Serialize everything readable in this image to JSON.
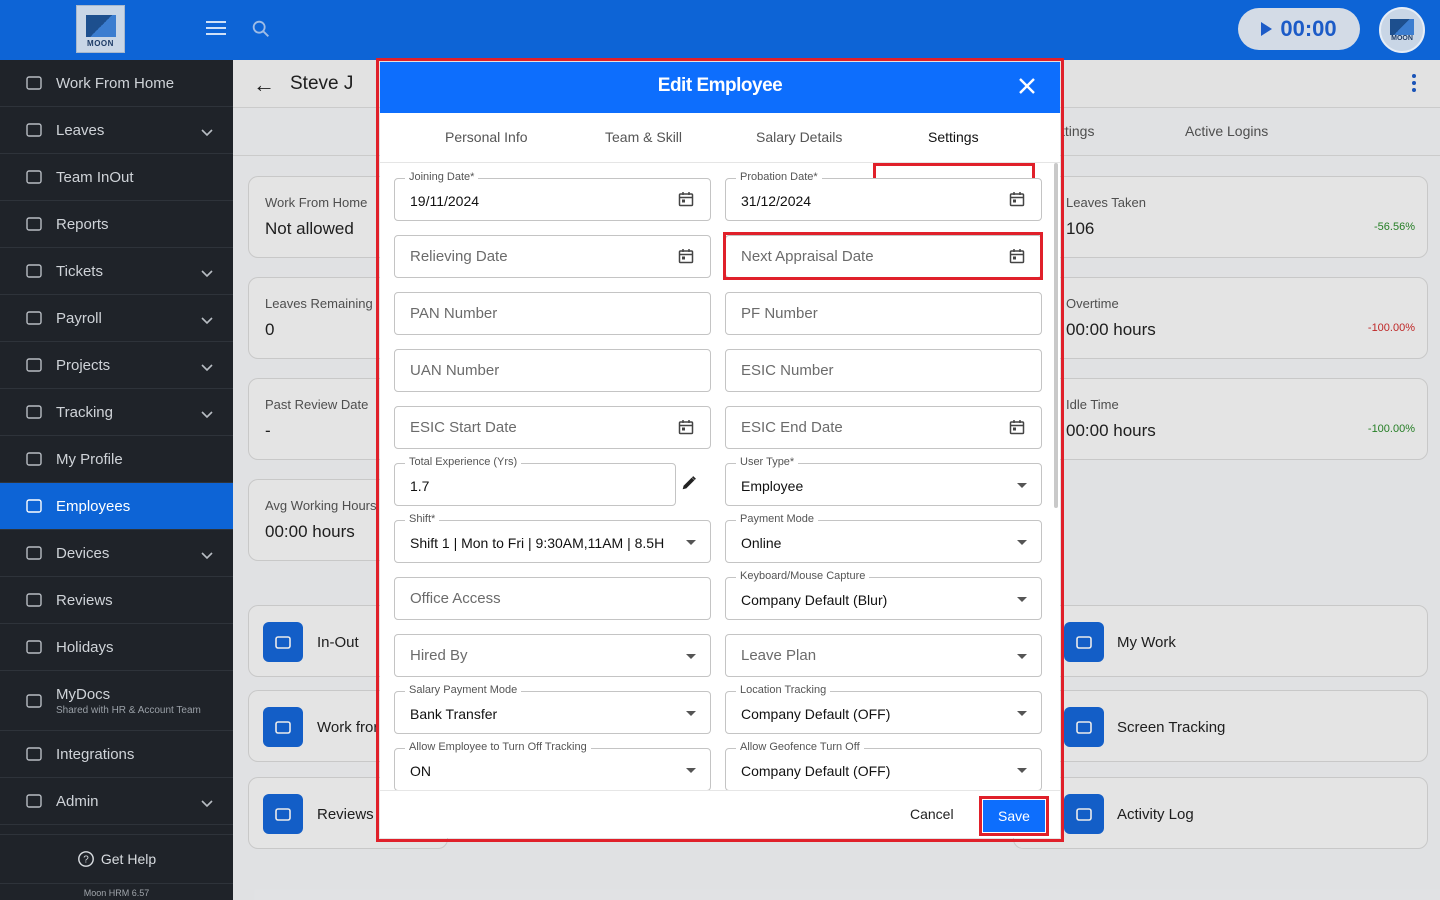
{
  "topbar": {
    "logo_text": "MOON",
    "timer": "00:00",
    "avatar_text": "MOON"
  },
  "sidebar": {
    "items": [
      {
        "label": "Work From Home",
        "icon": "home-icon",
        "has_chevron": false
      },
      {
        "label": "Leaves",
        "icon": "calendar-icon",
        "has_chevron": true
      },
      {
        "label": "Team InOut",
        "icon": "team-icon",
        "has_chevron": false
      },
      {
        "label": "Reports",
        "icon": "report-icon",
        "has_chevron": false
      },
      {
        "label": "Tickets",
        "icon": "ticket-icon",
        "has_chevron": true
      },
      {
        "label": "Payroll",
        "icon": "payroll-icon",
        "has_chevron": true
      },
      {
        "label": "Projects",
        "icon": "projects-icon",
        "has_chevron": true
      },
      {
        "label": "Tracking",
        "icon": "tracking-icon",
        "has_chevron": true
      },
      {
        "label": "My Profile",
        "icon": "user-icon",
        "has_chevron": false
      },
      {
        "label": "Employees",
        "icon": "employees-icon",
        "has_chevron": false,
        "active": true
      },
      {
        "label": "Devices",
        "icon": "devices-icon",
        "has_chevron": true
      },
      {
        "label": "Reviews",
        "icon": "reviews-icon",
        "has_chevron": false
      },
      {
        "label": "Holidays",
        "icon": "holidays-icon",
        "has_chevron": false
      },
      {
        "label": "MyDocs",
        "sub": "Shared with HR & Account Team",
        "icon": "folder-icon",
        "has_chevron": false
      },
      {
        "label": "Integrations",
        "icon": "integrations-icon",
        "has_chevron": false
      },
      {
        "label": "Admin",
        "icon": "admin-icon",
        "has_chevron": true
      }
    ],
    "get_help": "Get Help",
    "version": "Moon HRM 6.57"
  },
  "page": {
    "employee_name": "Steve J",
    "tabs": [
      "ttings",
      "Active Logins"
    ],
    "cards_left": [
      {
        "label": "Work From Home",
        "value": "Not allowed"
      },
      {
        "label": "Leaves Remaining",
        "value": "0"
      },
      {
        "label": "Past Review Date",
        "value": "-"
      },
      {
        "label": "Avg Working Hours",
        "value": "00:00 hours"
      }
    ],
    "cards_right": [
      {
        "label": "Leaves Taken",
        "value": "106",
        "pct": "-56.56%",
        "pct_color": "#2a8a2a"
      },
      {
        "label": "Overtime",
        "value": "00:00 hours",
        "pct": "-100.00%",
        "pct_color": "#d02b2b"
      },
      {
        "label": "Idle Time",
        "value": "00:00 hours",
        "pct": "-100.00%",
        "pct_color": "#2a8a2a"
      }
    ],
    "quick_left": [
      "In-Out",
      "Work fror",
      "Reviews"
    ],
    "quick_right": [
      "My Work",
      "Screen Tracking",
      "Activity Log"
    ]
  },
  "modal": {
    "title": "Edit Employee",
    "tabs": [
      "Personal Info",
      "Team & Skill",
      "Salary Details",
      "Settings"
    ],
    "active_tab": "Settings",
    "fields": {
      "joining_date": {
        "label": "Joining Date*",
        "value": "19/11/2024"
      },
      "probation_date": {
        "label": "Probation Date*",
        "value": "31/12/2024"
      },
      "relieving_date": {
        "placeholder": "Relieving Date"
      },
      "next_appraisal_date": {
        "placeholder": "Next Appraisal Date"
      },
      "pan_number": {
        "placeholder": "PAN Number"
      },
      "pf_number": {
        "placeholder": "PF Number"
      },
      "uan_number": {
        "placeholder": "UAN Number"
      },
      "esic_number": {
        "placeholder": "ESIC Number"
      },
      "esic_start_date": {
        "placeholder": "ESIC Start Date"
      },
      "esic_end_date": {
        "placeholder": "ESIC End Date"
      },
      "total_experience": {
        "label": "Total Experience (Yrs)",
        "value": "1.7"
      },
      "user_type": {
        "label": "User Type*",
        "value": "Employee"
      },
      "shift": {
        "label": "Shift*",
        "value": "Shift 1 | Mon to Fri | 9:30AM,11AM | 8.5H"
      },
      "payment_mode": {
        "label": "Payment Mode",
        "value": "Online"
      },
      "office_access": {
        "placeholder": "Office Access"
      },
      "keyboard_mouse_capture": {
        "label": "Keyboard/Mouse Capture",
        "value": "Company Default (Blur)"
      },
      "hired_by": {
        "placeholder": "Hired By"
      },
      "leave_plan": {
        "placeholder": "Leave Plan"
      },
      "salary_payment_mode": {
        "label": "Salary Payment Mode",
        "value": "Bank Transfer"
      },
      "location_tracking": {
        "label": "Location Tracking",
        "value": "Company Default (OFF)"
      },
      "allow_turn_off_tracking": {
        "label": "Allow Employee to Turn Off Tracking",
        "value": "ON"
      },
      "allow_geofence_turn_off": {
        "label": "Allow Geofence Turn Off",
        "value": "Company Default (OFF)"
      }
    },
    "cancel_label": "Cancel",
    "save_label": "Save"
  },
  "colors": {
    "primary": "#0d6efd",
    "sidebar_bg": "#1f2329",
    "highlight": "#e0202a"
  }
}
